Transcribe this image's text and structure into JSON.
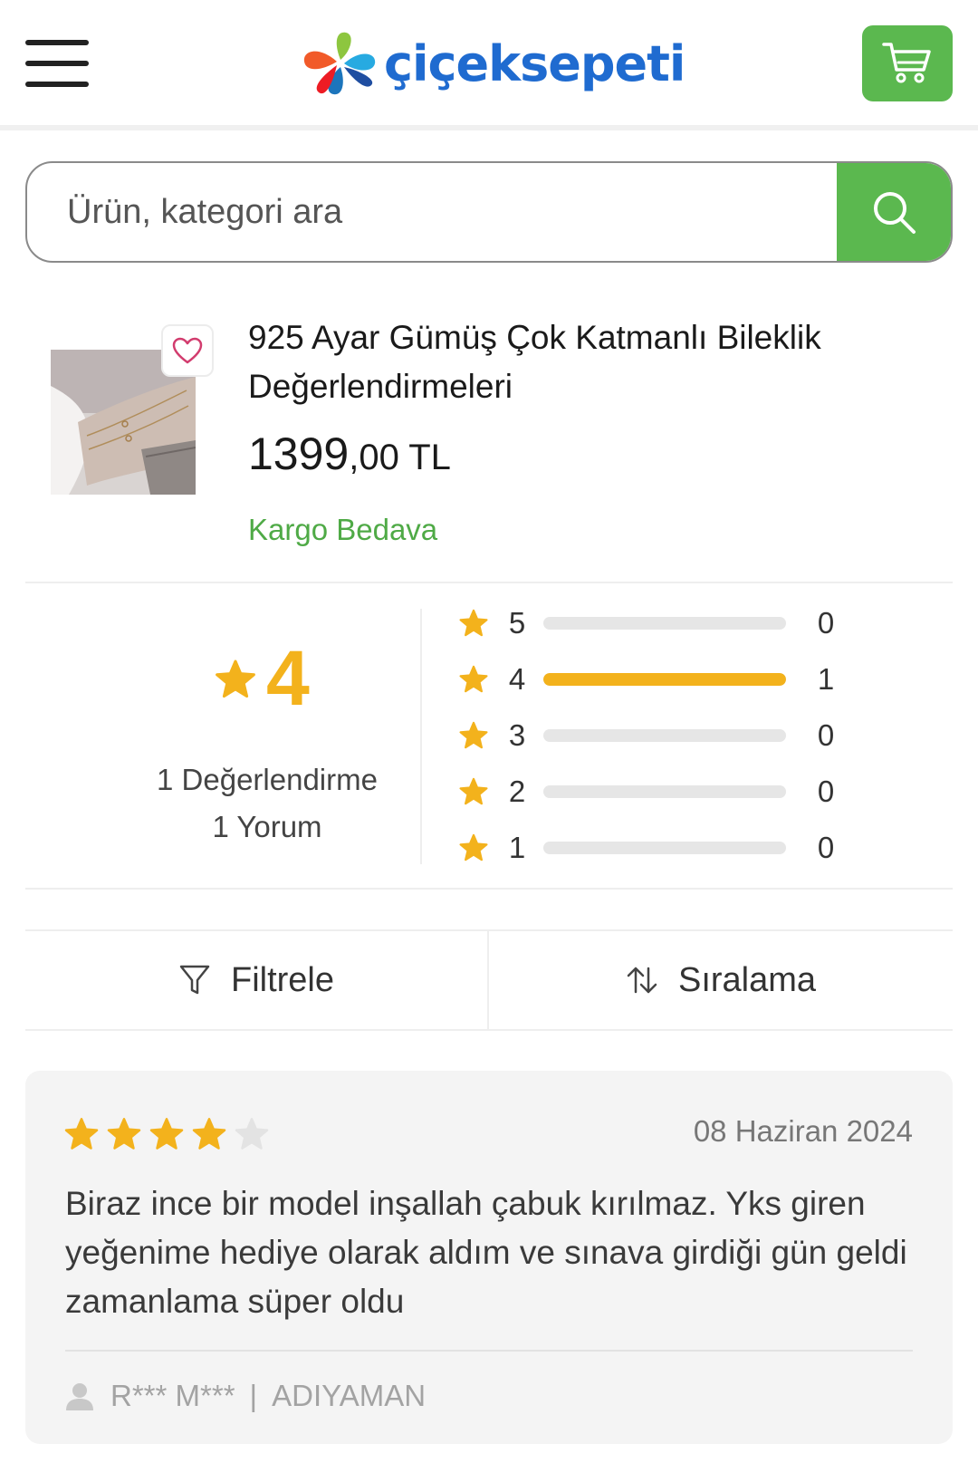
{
  "header": {
    "logo_text": "çiçeksepeti",
    "brand_color": "#1f6bd0",
    "accent_green": "#5bb84f"
  },
  "search": {
    "placeholder": "Ürün, kategori ara"
  },
  "product": {
    "title": "925 Ayar Gümüş Çok Katmanlı Bileklik Değerlendirmeleri",
    "price_int": "1399",
    "price_dec": ",00 TL",
    "shipping": "Kargo Bedava"
  },
  "rating": {
    "average": "4",
    "reviews_count": "1 Değerlendirme",
    "comments_count": "1 Yorum",
    "star_color": "#f3b21c",
    "breakdown": [
      {
        "stars": "5",
        "count": "0",
        "fraction": 0
      },
      {
        "stars": "4",
        "count": "1",
        "fraction": 1
      },
      {
        "stars": "3",
        "count": "0",
        "fraction": 0
      },
      {
        "stars": "2",
        "count": "0",
        "fraction": 0
      },
      {
        "stars": "1",
        "count": "0",
        "fraction": 0
      }
    ]
  },
  "toolbar": {
    "filter_label": "Filtrele",
    "sort_label": "Sıralama"
  },
  "review": {
    "rating": 4,
    "max_rating": 5,
    "date": "08 Haziran 2024",
    "text": "Biraz ince bir model inşallah çabuk kırılmaz. Yks giren yeğenime hediye olarak aldım ve sınava girdiği gün geldi zamanlama süper oldu",
    "author": "R*** M***",
    "separator": "|",
    "city": "ADIYAMAN"
  }
}
